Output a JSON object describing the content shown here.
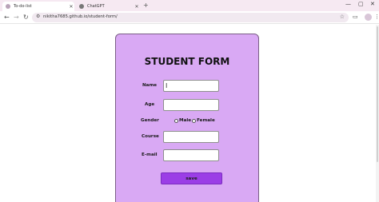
{
  "browser": {
    "tabs": [
      {
        "title": "To-do-list",
        "active": true
      },
      {
        "title": "ChatGPT",
        "active": false
      }
    ],
    "new_tab_icon": "plus-icon",
    "address": "nikitha7685.github.io/student-form/"
  },
  "page": {
    "card_color": "#d9a9f4",
    "title": "STUDENT FORM",
    "fields": {
      "name_label": "Name",
      "age_label": "Age",
      "gender_label": "Gender",
      "gender_male": "Male",
      "gender_female": "Female",
      "course_label": "Course",
      "email_label": "E-mail"
    },
    "save_label": "save",
    "button_color": "#9b3ee6"
  }
}
